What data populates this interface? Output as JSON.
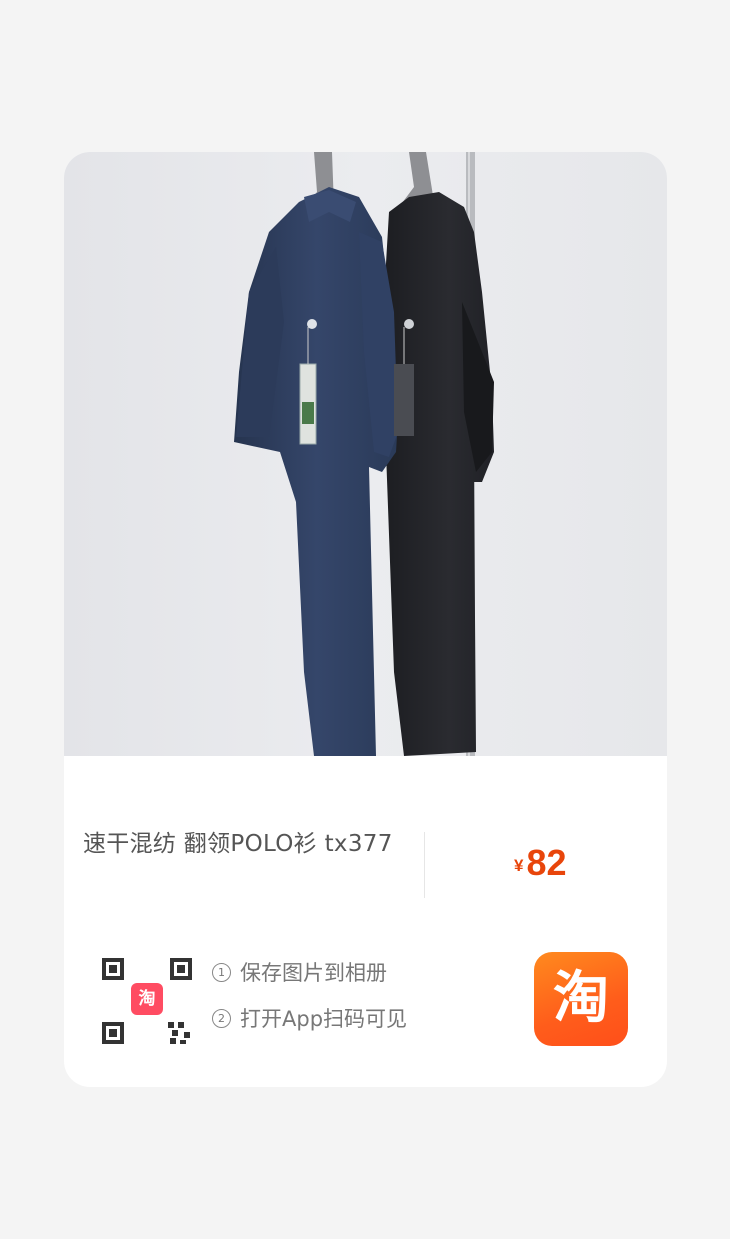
{
  "product": {
    "title": "速干混纺 翻领POLO衫 tx377",
    "currency": "¥",
    "price": "82"
  },
  "share": {
    "steps": [
      {
        "num": "1",
        "text": "保存图片到相册"
      },
      {
        "num": "2",
        "text": "打开App扫码可见"
      }
    ],
    "app_logo_char": "淘"
  },
  "colors": {
    "price": "#e8450b",
    "app_logo": "#ff5d1b",
    "background": "#f4f4f4"
  }
}
